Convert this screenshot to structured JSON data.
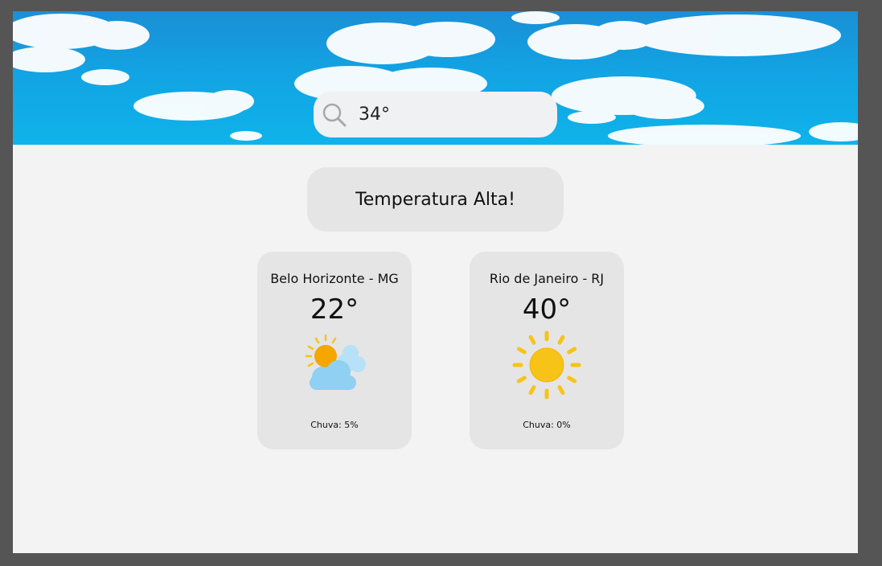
{
  "search": {
    "value": "34°",
    "icon": "search-icon"
  },
  "alert": {
    "text": "Temperatura Alta!"
  },
  "cards": [
    {
      "city": "Belo Horizonte - MG",
      "temp": "22°",
      "icon": "partly-cloudy-icon",
      "rain": "Chuva: 5%"
    },
    {
      "city": "Rio de Janeiro - RJ",
      "temp": "40°",
      "icon": "sun-icon",
      "rain": "Chuva: 0%"
    }
  ],
  "colors": {
    "sky": "#12a3e3",
    "page": "#f3f3f4",
    "card": "#e5e5e6",
    "sun": "#f7c318",
    "cloud": "#8fd0f3"
  }
}
